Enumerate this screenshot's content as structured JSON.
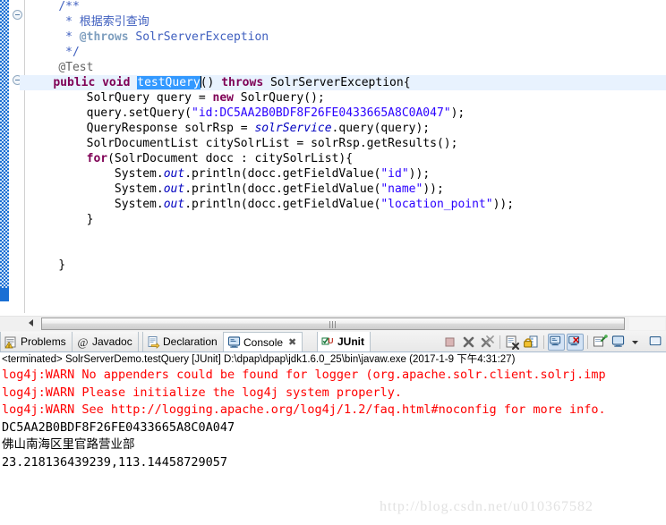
{
  "editor": {
    "fold_icons": [
      "fold-collapse-comment",
      "fold-collapse-method"
    ],
    "partial_top_line": "}",
    "code_lines": [
      {
        "indent": "    ",
        "parts": [
          {
            "t": "/**",
            "c": "cm"
          }
        ]
      },
      {
        "indent": "     ",
        "parts": [
          {
            "t": "* ",
            "c": "cm"
          },
          {
            "t": "根据索引查询",
            "c": "cm"
          }
        ]
      },
      {
        "indent": "     ",
        "parts": [
          {
            "t": "* ",
            "c": "cm"
          },
          {
            "t": "@throws",
            "c": "cmtag"
          },
          {
            "t": " SolrServerException",
            "c": "cm"
          }
        ]
      },
      {
        "indent": "     ",
        "parts": [
          {
            "t": "*/",
            "c": "cm"
          }
        ]
      },
      {
        "indent": "    ",
        "parts": [
          {
            "t": "@Test",
            "c": "ann"
          }
        ]
      },
      {
        "indent": "    ",
        "current": true,
        "parts": [
          {
            "t": "public",
            "c": "kw"
          },
          {
            "t": " ",
            "c": ""
          },
          {
            "t": "void",
            "c": "kw"
          },
          {
            "t": " ",
            "c": ""
          },
          {
            "t": "testQuery",
            "c": "sel"
          },
          {
            "t": "|caret|",
            "c": "caret"
          },
          {
            "t": "() ",
            "c": ""
          },
          {
            "t": "throws",
            "c": "kw"
          },
          {
            "t": " SolrServerException{",
            "c": ""
          }
        ]
      },
      {
        "indent": "        ",
        "parts": [
          {
            "t": "SolrQuery query = ",
            "c": ""
          },
          {
            "t": "new",
            "c": "kw"
          },
          {
            "t": " SolrQuery();",
            "c": ""
          }
        ]
      },
      {
        "indent": "        ",
        "parts": [
          {
            "t": "query.setQuery(",
            "c": ""
          },
          {
            "t": "\"id:DC5AA2B0BDF8F26FE0433665A8C0A047\"",
            "c": "str"
          },
          {
            "t": ");",
            "c": ""
          }
        ]
      },
      {
        "indent": "        ",
        "parts": [
          {
            "t": "QueryResponse solrRsp = ",
            "c": ""
          },
          {
            "t": "solrService",
            "c": "fld"
          },
          {
            "t": ".query(query);",
            "c": ""
          }
        ]
      },
      {
        "indent": "        ",
        "parts": [
          {
            "t": "SolrDocumentList citySolrList = solrRsp.getResults();",
            "c": ""
          }
        ]
      },
      {
        "indent": "        ",
        "parts": [
          {
            "t": "for",
            "c": "kw"
          },
          {
            "t": "(SolrDocument docc : citySolrList){",
            "c": ""
          }
        ]
      },
      {
        "indent": "            ",
        "parts": [
          {
            "t": "System.",
            "c": ""
          },
          {
            "t": "out",
            "c": "fld"
          },
          {
            "t": ".println(docc.getFieldValue(",
            "c": ""
          },
          {
            "t": "\"id\"",
            "c": "str"
          },
          {
            "t": "));",
            "c": ""
          }
        ]
      },
      {
        "indent": "            ",
        "parts": [
          {
            "t": "System.",
            "c": ""
          },
          {
            "t": "out",
            "c": "fld"
          },
          {
            "t": ".println(docc.getFieldValue(",
            "c": ""
          },
          {
            "t": "\"name\"",
            "c": "str"
          },
          {
            "t": "));",
            "c": ""
          }
        ]
      },
      {
        "indent": "            ",
        "parts": [
          {
            "t": "System.",
            "c": ""
          },
          {
            "t": "out",
            "c": "fld"
          },
          {
            "t": ".println(docc.getFieldValue(",
            "c": ""
          },
          {
            "t": "\"location_point\"",
            "c": "str"
          },
          {
            "t": "));",
            "c": ""
          }
        ]
      },
      {
        "indent": "        ",
        "parts": [
          {
            "t": "}",
            "c": ""
          }
        ]
      },
      {
        "indent": "",
        "parts": [
          {
            "t": "",
            "c": ""
          }
        ]
      },
      {
        "indent": "",
        "parts": [
          {
            "t": "",
            "c": ""
          }
        ]
      },
      {
        "indent": "    ",
        "parts": [
          {
            "t": "}",
            "c": ""
          }
        ]
      }
    ],
    "scrollbar": {
      "name": "editor-horizontal-scrollbar"
    }
  },
  "tabs": [
    {
      "label": "Problems",
      "icon": "problems-icon",
      "active": false,
      "closable": false
    },
    {
      "label": "Javadoc",
      "icon": "javadoc-at-icon",
      "active": false,
      "closable": false
    },
    {
      "label": "Declaration",
      "icon": "declaration-icon",
      "active": false,
      "closable": false
    },
    {
      "label": "Console",
      "icon": "console-icon",
      "active": true,
      "closable": true,
      "close_glyph": "✖"
    },
    {
      "label": "JUnit",
      "icon": "junit-icon",
      "active": false,
      "closable": false
    }
  ],
  "console_toolbar": [
    {
      "name": "terminate-button",
      "icon": "stop-square-icon",
      "pressed": false
    },
    {
      "name": "remove-launch-button",
      "icon": "x-mark-icon",
      "pressed": false
    },
    {
      "name": "remove-all-terminated-button",
      "icon": "double-x-mark-icon",
      "pressed": false
    },
    {
      "name": "clear-console-button",
      "icon": "clear-console-icon",
      "pressed": false
    },
    {
      "name": "scroll-lock-button",
      "icon": "lock-icon",
      "pressed": false
    },
    {
      "name": "show-console-on-output-button",
      "icon": "console-out-icon",
      "pressed": true
    },
    {
      "name": "show-console-on-error-button",
      "icon": "console-err-icon",
      "pressed": true
    },
    {
      "name": "pin-console-button",
      "icon": "pin-icon",
      "pressed": false
    },
    {
      "name": "display-selected-console-button",
      "icon": "display-console-icon",
      "pressed": false
    },
    {
      "name": "console-dropdown-button",
      "icon": "chevron-down-icon",
      "pressed": false
    },
    {
      "name": "open-console-button",
      "icon": "new-console-icon",
      "pressed": false
    }
  ],
  "console": {
    "terminated_line": "<terminated> SolrServerDemo.testQuery [JUnit] D:\\dpap\\dpap\\jdk1.6.0_25\\bin\\javaw.exe (2017-1-9 下午4:31:27)",
    "lines": [
      {
        "text": "log4j:WARN No appenders could be found for logger (org.apache.solr.client.solrj.imp",
        "stream": "err"
      },
      {
        "text": "log4j:WARN Please initialize the log4j system properly.",
        "stream": "err"
      },
      {
        "text": "log4j:WARN See http://logging.apache.org/log4j/1.2/faq.html#noconfig for more info.",
        "stream": "err"
      },
      {
        "text": "DC5AA2B0BDF8F26FE0433665A8C0A047",
        "stream": "out"
      },
      {
        "text": "佛山南海区里官路营业部",
        "stream": "out"
      },
      {
        "text": "23.218136439239,113.14458729057",
        "stream": "out"
      }
    ]
  },
  "watermark": {
    "text": "http://blog.csdn.net/u010367582"
  },
  "colors": {
    "keyword": "#7f0055",
    "comment": "#3f5fbf",
    "string": "#2a00ff",
    "field": "#0000c0",
    "annotation": "#646464",
    "selection": "#3399ff",
    "current_line": "#e8f2fe",
    "error_text": "#ff0000",
    "change_bar": "#1a6fd4"
  }
}
